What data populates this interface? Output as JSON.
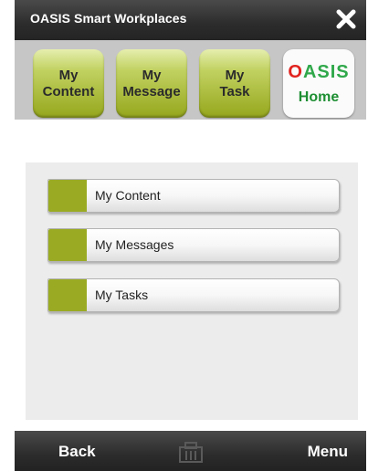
{
  "titlebar": {
    "title": "OASIS Smart Workplaces"
  },
  "nav": {
    "items": [
      {
        "label": "My\nContent"
      },
      {
        "label": "My\nMessage"
      },
      {
        "label": "My\nTask"
      }
    ],
    "home": {
      "logo_first": "O",
      "logo_rest": "ASIS",
      "label": "Home"
    }
  },
  "list": [
    {
      "label": "My Content"
    },
    {
      "label": "My Messages"
    },
    {
      "label": "My Tasks"
    }
  ],
  "bottombar": {
    "back_label": "Back",
    "menu_label": "Menu"
  },
  "colors": {
    "accent": "#9aab23",
    "home_green": "#1e8f33",
    "logo_red": "#e1231f",
    "bar": "#2c2c2c"
  }
}
